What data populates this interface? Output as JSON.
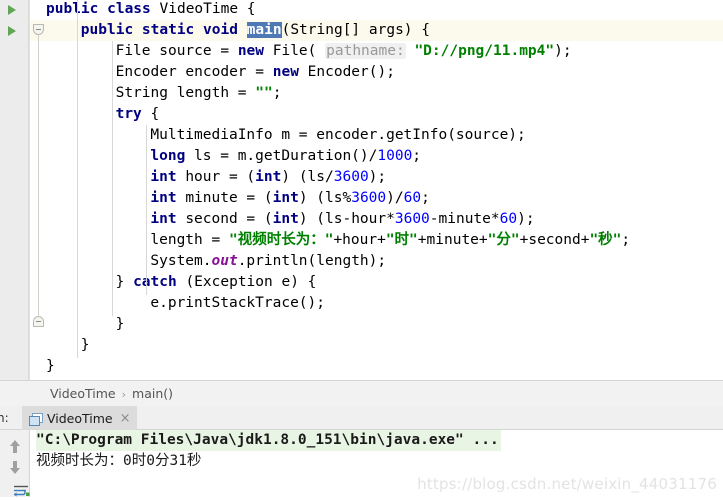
{
  "editor": {
    "lines": [
      {
        "indent": 0,
        "highlight": false,
        "run_arrow": true,
        "tokens": [
          {
            "t": "public ",
            "c": "kw"
          },
          {
            "t": "class ",
            "c": "kw"
          },
          {
            "t": "VideoTime {",
            "c": "plain"
          }
        ]
      },
      {
        "indent": 1,
        "highlight": true,
        "run_arrow": true,
        "tokens": [
          {
            "t": "public ",
            "c": "kw"
          },
          {
            "t": "static ",
            "c": "kw"
          },
          {
            "t": "void ",
            "c": "kw"
          },
          {
            "t": "main",
            "c": "sel"
          },
          {
            "t": "(String[] args) {",
            "c": "plain"
          }
        ]
      },
      {
        "indent": 2,
        "highlight": false,
        "run_arrow": false,
        "tokens": [
          {
            "t": "File source = ",
            "c": "plain"
          },
          {
            "t": "new ",
            "c": "kw"
          },
          {
            "t": "File( ",
            "c": "plain"
          },
          {
            "t": "pathname:",
            "c": "hint"
          },
          {
            "t": " ",
            "c": "plain"
          },
          {
            "t": "\"D://png/11.mp4\"",
            "c": "str"
          },
          {
            "t": ");",
            "c": "plain"
          }
        ]
      },
      {
        "indent": 2,
        "highlight": false,
        "run_arrow": false,
        "tokens": [
          {
            "t": "Encoder encoder = ",
            "c": "plain"
          },
          {
            "t": "new ",
            "c": "kw"
          },
          {
            "t": "Encoder();",
            "c": "plain"
          }
        ]
      },
      {
        "indent": 2,
        "highlight": false,
        "run_arrow": false,
        "tokens": [
          {
            "t": "String length = ",
            "c": "plain"
          },
          {
            "t": "\"\"",
            "c": "str"
          },
          {
            "t": ";",
            "c": "plain"
          }
        ]
      },
      {
        "indent": 2,
        "highlight": false,
        "run_arrow": false,
        "tokens": [
          {
            "t": "try",
            "c": "kw"
          },
          {
            "t": " {",
            "c": "plain"
          }
        ]
      },
      {
        "indent": 3,
        "highlight": false,
        "run_arrow": false,
        "tokens": [
          {
            "t": "MultimediaInfo m = encoder.getInfo(source);",
            "c": "plain"
          }
        ]
      },
      {
        "indent": 3,
        "highlight": false,
        "run_arrow": false,
        "tokens": [
          {
            "t": "long ",
            "c": "kw"
          },
          {
            "t": "ls = m.getDuration()/",
            "c": "plain"
          },
          {
            "t": "1000",
            "c": "num"
          },
          {
            "t": ";",
            "c": "plain"
          }
        ]
      },
      {
        "indent": 3,
        "highlight": false,
        "run_arrow": false,
        "tokens": [
          {
            "t": "int ",
            "c": "kw"
          },
          {
            "t": "hour = (",
            "c": "plain"
          },
          {
            "t": "int",
            "c": "kw"
          },
          {
            "t": ") (ls/",
            "c": "plain"
          },
          {
            "t": "3600",
            "c": "num"
          },
          {
            "t": ");",
            "c": "plain"
          }
        ]
      },
      {
        "indent": 3,
        "highlight": false,
        "run_arrow": false,
        "tokens": [
          {
            "t": "int ",
            "c": "kw"
          },
          {
            "t": "minute = (",
            "c": "plain"
          },
          {
            "t": "int",
            "c": "kw"
          },
          {
            "t": ") (ls%",
            "c": "plain"
          },
          {
            "t": "3600",
            "c": "num"
          },
          {
            "t": ")/",
            "c": "plain"
          },
          {
            "t": "60",
            "c": "num"
          },
          {
            "t": ";",
            "c": "plain"
          }
        ]
      },
      {
        "indent": 3,
        "highlight": false,
        "run_arrow": false,
        "tokens": [
          {
            "t": "int ",
            "c": "kw"
          },
          {
            "t": "second = (",
            "c": "plain"
          },
          {
            "t": "int",
            "c": "kw"
          },
          {
            "t": ") (ls-hour*",
            "c": "plain"
          },
          {
            "t": "3600",
            "c": "num"
          },
          {
            "t": "-minute*",
            "c": "plain"
          },
          {
            "t": "60",
            "c": "num"
          },
          {
            "t": ");",
            "c": "plain"
          }
        ]
      },
      {
        "indent": 3,
        "highlight": false,
        "run_arrow": false,
        "tokens": [
          {
            "t": "length = ",
            "c": "plain"
          },
          {
            "t": "\"视频时长为：\"",
            "c": "str"
          },
          {
            "t": "+hour+",
            "c": "plain"
          },
          {
            "t": "\"时\"",
            "c": "str"
          },
          {
            "t": "+minute+",
            "c": "plain"
          },
          {
            "t": "\"分\"",
            "c": "str"
          },
          {
            "t": "+second+",
            "c": "plain"
          },
          {
            "t": "\"秒\"",
            "c": "str"
          },
          {
            "t": ";",
            "c": "plain"
          }
        ]
      },
      {
        "indent": 3,
        "highlight": false,
        "run_arrow": false,
        "tokens": [
          {
            "t": "System.",
            "c": "plain"
          },
          {
            "t": "out",
            "c": "fld"
          },
          {
            "t": ".println(length);",
            "c": "plain"
          }
        ]
      },
      {
        "indent": 2,
        "highlight": false,
        "run_arrow": false,
        "tokens": [
          {
            "t": "} ",
            "c": "plain"
          },
          {
            "t": "catch ",
            "c": "kw"
          },
          {
            "t": "(Exception e) {",
            "c": "plain"
          }
        ]
      },
      {
        "indent": 3,
        "highlight": false,
        "run_arrow": false,
        "tokens": [
          {
            "t": "e.printStackTrace();",
            "c": "plain"
          }
        ]
      },
      {
        "indent": 2,
        "highlight": false,
        "run_arrow": false,
        "tokens": [
          {
            "t": "}",
            "c": "plain"
          }
        ]
      },
      {
        "indent": 1,
        "highlight": false,
        "run_arrow": false,
        "tokens": [
          {
            "t": "}",
            "c": "plain"
          }
        ]
      },
      {
        "indent": 0,
        "highlight": false,
        "run_arrow": false,
        "tokens": [
          {
            "t": "}",
            "c": "plain"
          }
        ]
      }
    ]
  },
  "breadcrumb": {
    "items": [
      "VideoTime",
      "main()"
    ],
    "separator": "›"
  },
  "run_window": {
    "label": "n:",
    "tab_title": "VideoTime",
    "tab_close": "×",
    "icons": {
      "up": "arrow-up-icon",
      "down": "arrow-down-icon",
      "wrap": "soft-wrap-icon",
      "tab": "run-configuration-icon"
    },
    "console": {
      "command": "\"C:\\Program Files\\Java\\jdk1.8.0_151\\bin\\java.exe\" ...",
      "output": "视频时长为：0时0分31秒"
    }
  },
  "watermark": "https://blog.csdn.net/weixin_44031176",
  "colors": {
    "keyword": "#000080",
    "string": "#008000",
    "number": "#0000ff",
    "field": "#871094",
    "selection": "#4f79b5",
    "highlight_line": "#fcfaed",
    "console_cmd_bg": "#e9f5e4",
    "gutter": "#ececec",
    "run_arrow": "#62a555"
  }
}
